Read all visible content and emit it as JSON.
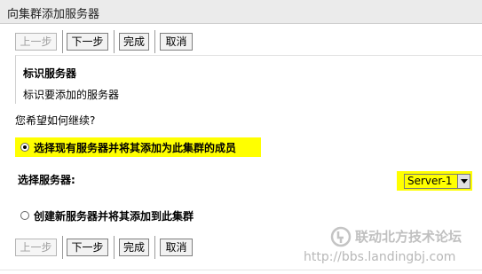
{
  "window": {
    "title": "向集群添加服务器"
  },
  "toolbar_top": {
    "prev": "上一步",
    "next": "下一步",
    "finish": "完成",
    "cancel": "取消"
  },
  "section": {
    "title": "标识服务器",
    "description": "标识要添加的服务器"
  },
  "prompt": "您希望如何继续?",
  "options": [
    {
      "label": "选择现有服务器并将其添加为此集群的成员",
      "selected": true
    },
    {
      "label": "创建新服务器并将其添加到此集群",
      "selected": false
    }
  ],
  "server_select": {
    "label": "选择服务器:",
    "value": "Server-1"
  },
  "toolbar_bottom": {
    "prev": "上一步",
    "next": "下一步",
    "finish": "完成",
    "cancel": "取消"
  },
  "watermark": {
    "name": "联动北方技术论坛",
    "url": "http://bbs.landingbj.com"
  },
  "colors": {
    "highlight": "#ffff00",
    "title_bar": "#ebebeb"
  }
}
